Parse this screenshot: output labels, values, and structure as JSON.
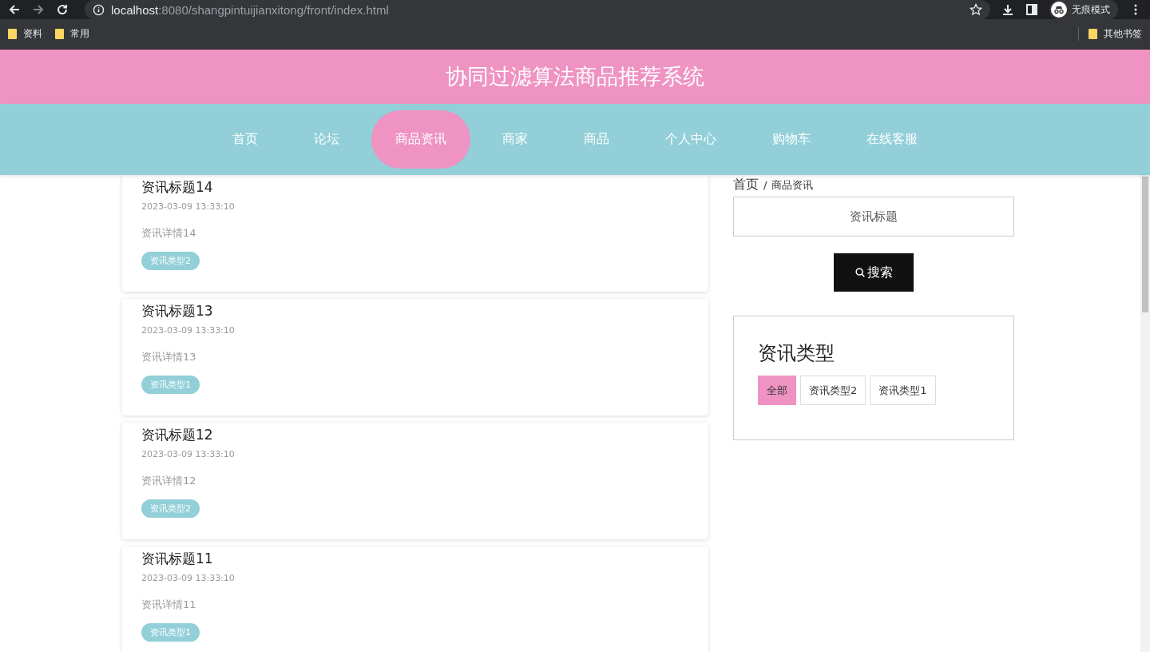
{
  "browser": {
    "url_host": "localhost",
    "url_rest": ":8080/shangpintuijianxitong/front/index.html",
    "profile": "无痕模式",
    "bookmarks": [
      "资料",
      "常用"
    ],
    "other_bookmarks": "其他书签"
  },
  "header": {
    "title": "协同过滤算法商品推荐系统"
  },
  "nav": [
    {
      "label": "首页",
      "selected": false
    },
    {
      "label": "论坛",
      "selected": false
    },
    {
      "label": "商品资讯",
      "selected": true
    },
    {
      "label": "商家",
      "selected": false
    },
    {
      "label": "商品",
      "selected": false
    },
    {
      "label": "个人中心",
      "selected": false
    },
    {
      "label": "购物车",
      "selected": false
    },
    {
      "label": "在线客服",
      "selected": false
    }
  ],
  "breadcrumb": [
    "首页",
    "/",
    "商品资讯"
  ],
  "search": {
    "placeholder": "资讯标题",
    "button": "搜索"
  },
  "categories": {
    "title": "资讯类型",
    "items": [
      {
        "label": "全部",
        "selected": true
      },
      {
        "label": "资讯类型2",
        "selected": false
      },
      {
        "label": "资讯类型1",
        "selected": false
      }
    ]
  },
  "news": [
    {
      "title": "资讯标题14",
      "time": "2023-03-09 13:33:10",
      "detail": "资讯详情14",
      "tag": "资讯类型2"
    },
    {
      "title": "资讯标题13",
      "time": "2023-03-09 13:33:10",
      "detail": "资讯详情13",
      "tag": "资讯类型1"
    },
    {
      "title": "资讯标题12",
      "time": "2023-03-09 13:33:10",
      "detail": "资讯详情12",
      "tag": "资讯类型2"
    },
    {
      "title": "资讯标题11",
      "time": "2023-03-09 13:33:10",
      "detail": "资讯详情11",
      "tag": "资讯类型1"
    }
  ]
}
